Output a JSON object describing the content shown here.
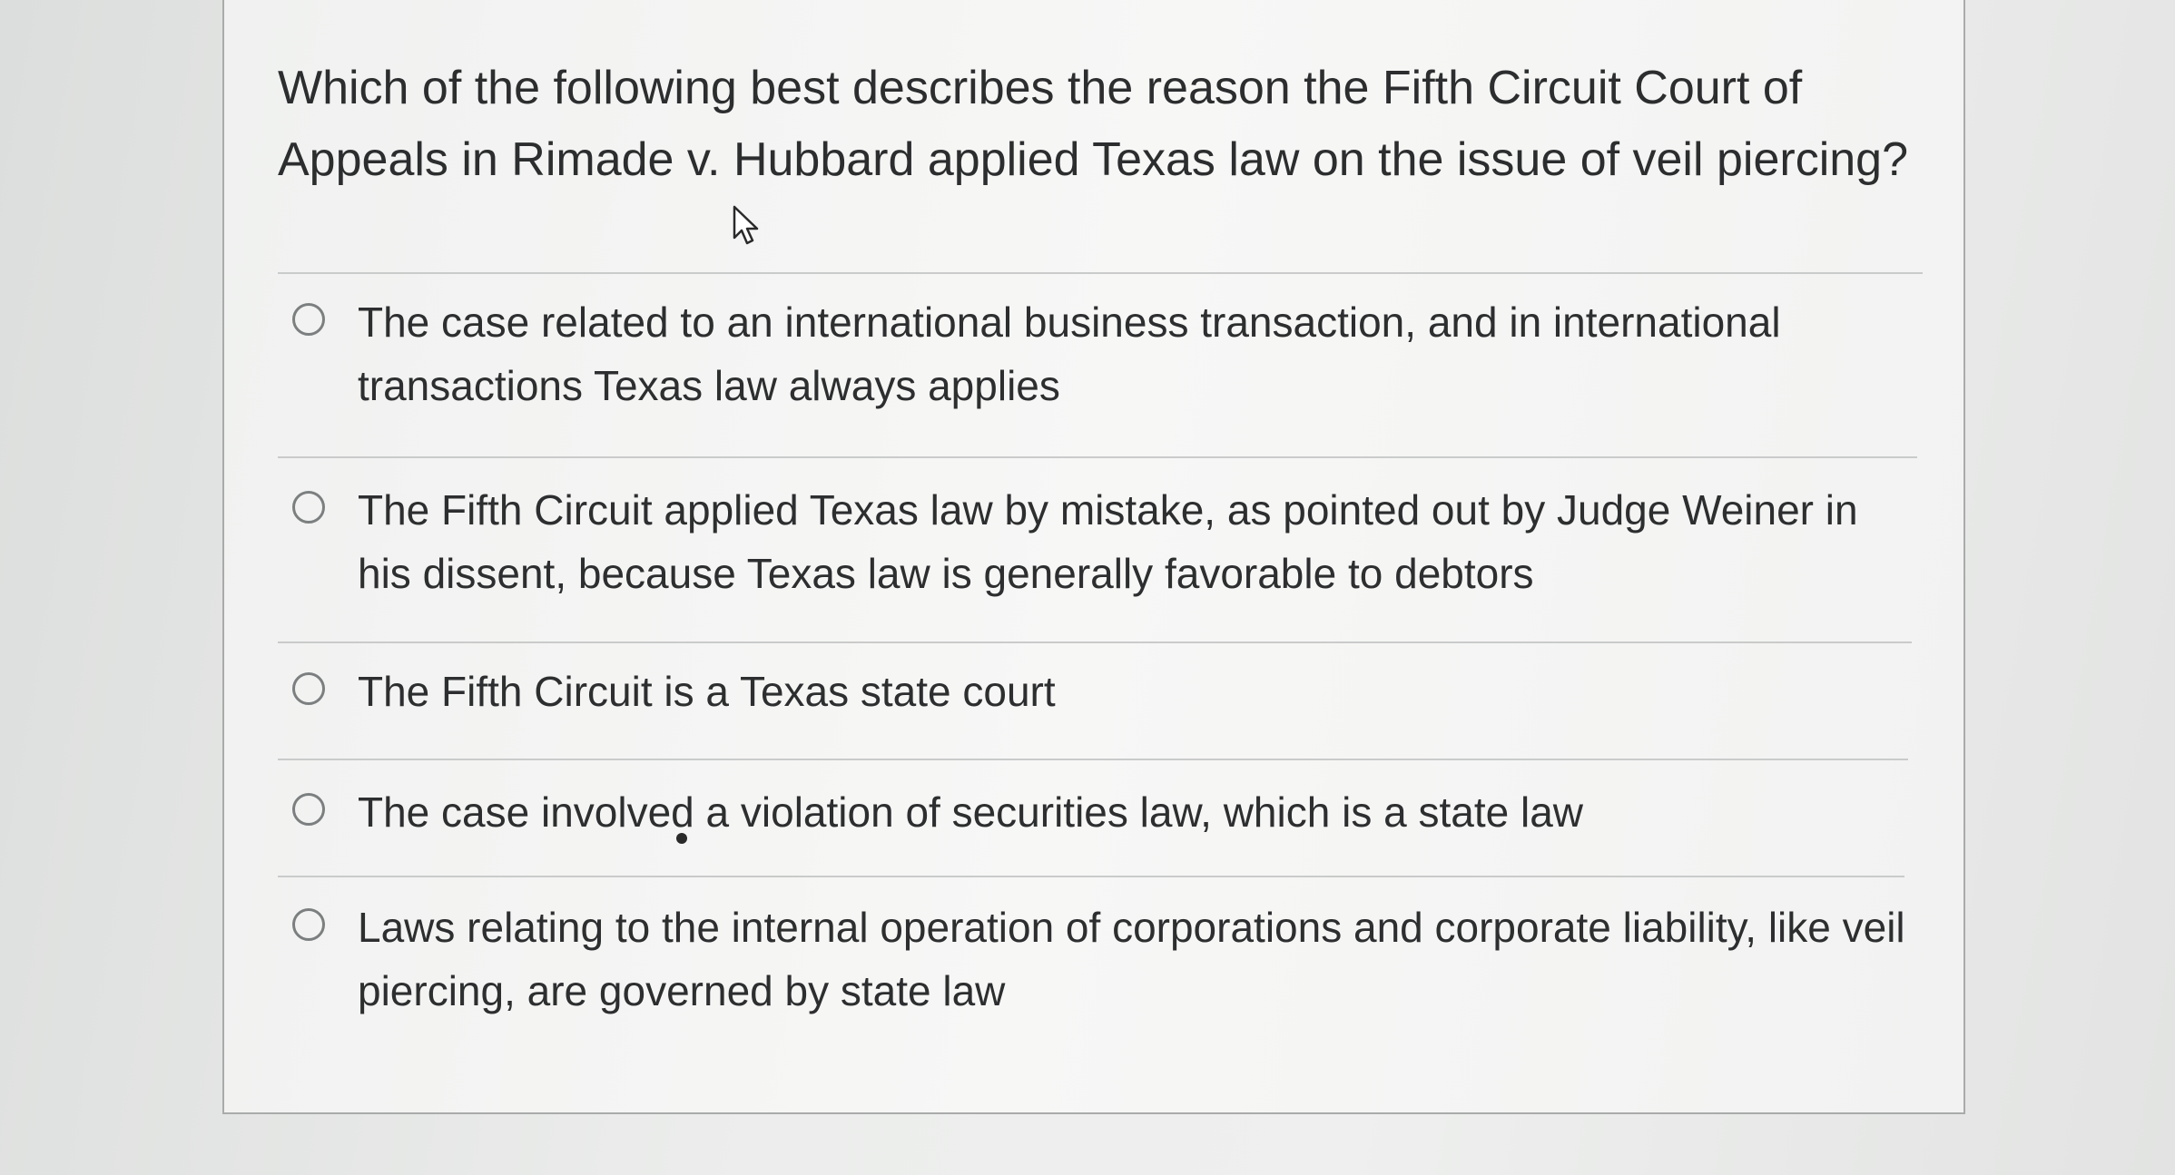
{
  "question": {
    "text": "Which of the following best describes the reason the Fifth Circuit Court of Appeals in Rimade v. Hubbard applied Texas law on the issue of veil piercing?"
  },
  "cursor": {
    "icon": "pointer-arrow-icon"
  },
  "options": [
    {
      "label": "The case related to an international business transaction, and in international transactions Texas law always applies",
      "selected": false
    },
    {
      "label": "The Fifth Circuit applied Texas law by mistake, as pointed out by Judge Weiner in his dissent, because Texas law is generally favorable to debtors",
      "selected": false
    },
    {
      "label": "The Fifth Circuit is a Texas state court",
      "selected": false
    },
    {
      "label": "The case involved a violation of securities law, which is a state law",
      "selected": false
    },
    {
      "label": "Laws relating to the internal operation of corporations and corporate liability, like veil piercing, are governed by state law",
      "selected": false
    }
  ],
  "colors": {
    "text": "#2c2d2e",
    "card_background": "#f5f5f4",
    "page_background": "#e6e7e7",
    "divider": "#c9cbca",
    "radio_border": "#7c7f80"
  }
}
